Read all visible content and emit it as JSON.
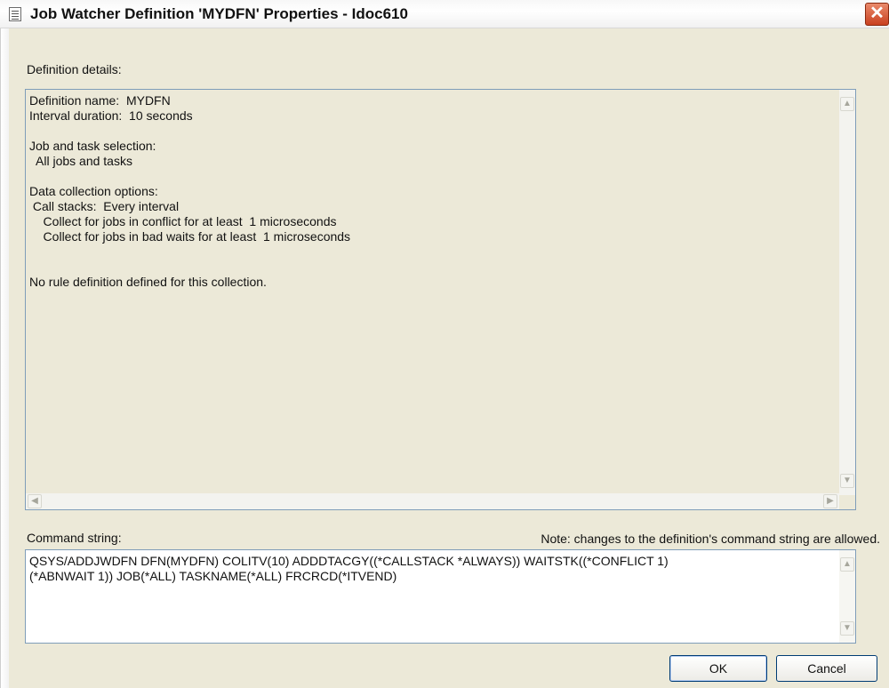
{
  "window": {
    "title": "Job Watcher Definition 'MYDFN' Properties - Idoc610",
    "close_glyph": "✕"
  },
  "details": {
    "label": "Definition details:",
    "lines": [
      "Definition name:  MYDFN",
      "Interval duration:  10 seconds",
      "",
      "Job and task selection:",
      "  All jobs and tasks",
      "",
      "Data collection options:",
      " Call stacks:  Every interval",
      "    Collect for jobs in conflict for at least  1 microseconds",
      "    Collect for jobs in bad waits for at least  1 microseconds",
      "",
      "",
      "No rule definition defined for this collection."
    ]
  },
  "command": {
    "label": "Command string:",
    "note": "Note: changes to the definition's command string are allowed.",
    "lines": [
      "QSYS/ADDJWDFN DFN(MYDFN) COLITV(10) ADDDTACGY((*CALLSTACK *ALWAYS)) WAITSTK((*CONFLICT 1)",
      "(*ABNWAIT 1)) JOB(*ALL) TASKNAME(*ALL) FRCRCD(*ITVEND)"
    ]
  },
  "buttons": {
    "ok_label": "OK",
    "cancel_label": "Cancel"
  },
  "icons": {
    "up": "▲",
    "down": "▼",
    "left": "◀",
    "right": "▶"
  }
}
